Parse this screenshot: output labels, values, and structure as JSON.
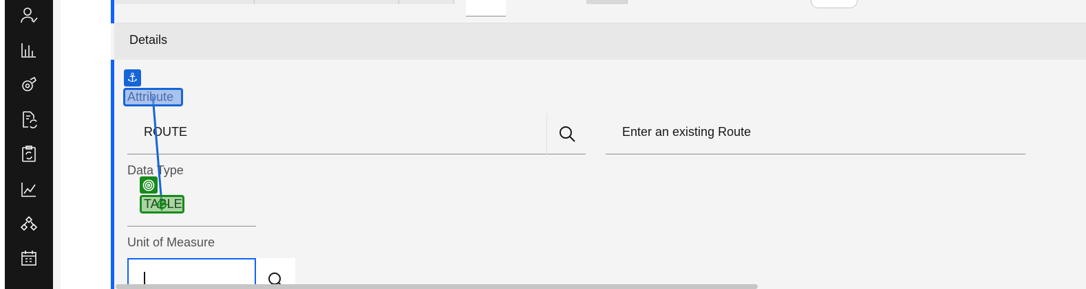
{
  "sidebar": {
    "icons": [
      "user-check-icon",
      "bar-chart-icon",
      "assets-icon",
      "document-sync-icon",
      "clipboard-sync-icon",
      "line-chart-icon",
      "hierarchy-icon",
      "calendar-icon"
    ]
  },
  "details": {
    "title": "Details"
  },
  "form": {
    "attribute_label": "Attribute",
    "route_value": "ROUTE",
    "route_description": "Enter an existing Route",
    "data_type_label": "Data Type",
    "data_type_value": "TABLE",
    "uom_label": "Unit of Measure",
    "uom_value": ""
  },
  "colors": {
    "accent": "#0f62fe",
    "rail": "#161616",
    "annotation_source": "#1565d8",
    "annotation_target": "#178a1c"
  }
}
